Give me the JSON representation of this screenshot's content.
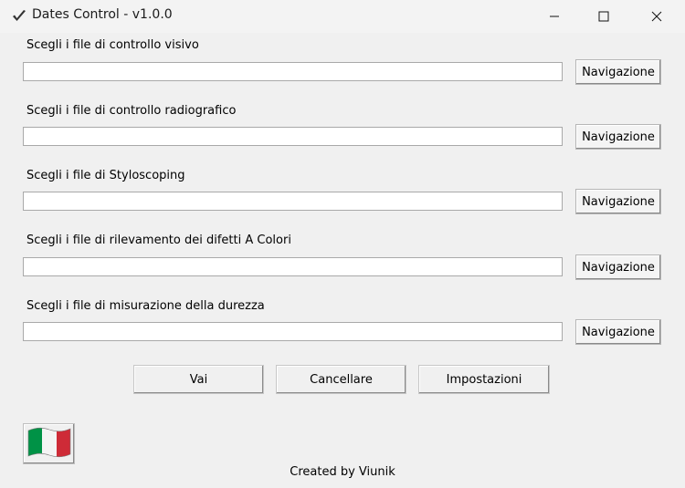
{
  "window": {
    "title": "Dates Control - v1.0.0",
    "icon": "checkmark-icon",
    "controls": [
      "minimize-icon",
      "maximize-icon",
      "close-icon"
    ]
  },
  "file_rows": [
    {
      "label": "Scegli i file di controllo visivo",
      "value": "",
      "button": "Navigazione"
    },
    {
      "label": "Scegli i file di controllo radiografico",
      "value": "",
      "button": "Navigazione"
    },
    {
      "label": "Scegli i file di Styloscoping",
      "value": "",
      "button": "Navigazione"
    },
    {
      "label": "Scegli i file di rilevamento dei difetti A Colori",
      "value": "",
      "button": "Navigazione"
    },
    {
      "label": "Scegli i file di misurazione della durezza",
      "value": "",
      "button": "Navigazione"
    }
  ],
  "actions": {
    "go": "Vai",
    "cancel": "Cancellare",
    "settings": "Impostazioni"
  },
  "language_flag": {
    "icon": "italy-flag-icon",
    "colors": [
      "#009246",
      "#ffffff",
      "#ce2b37"
    ]
  },
  "footer": "Created by Viunik"
}
